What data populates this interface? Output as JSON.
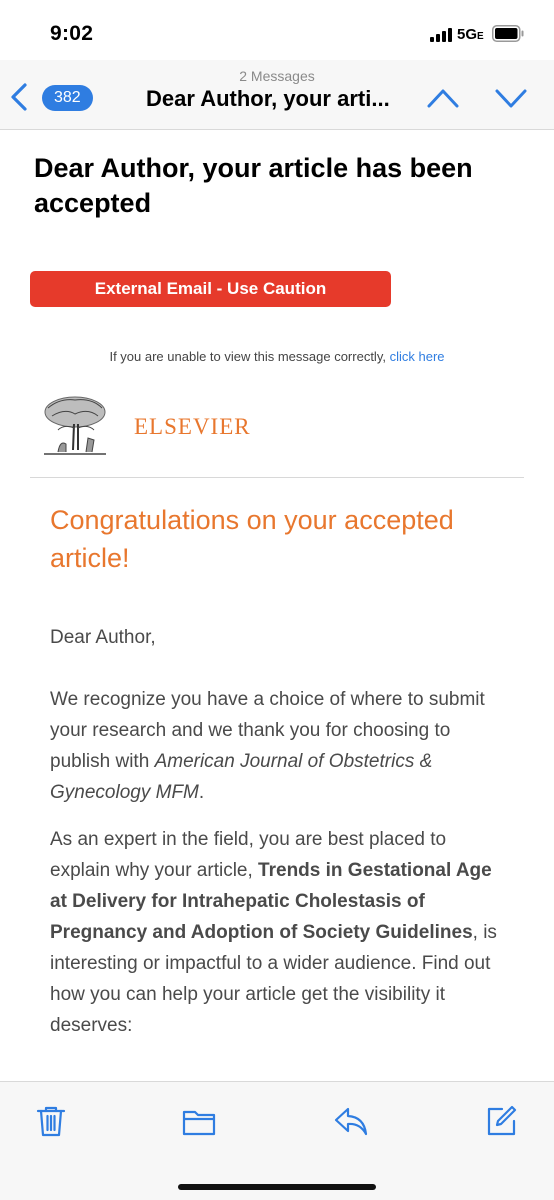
{
  "status_bar": {
    "time": "9:02",
    "network": "5G",
    "network_suffix": "E",
    "icons": [
      "signal-bars-icon",
      "battery-icon"
    ]
  },
  "nav": {
    "message_count_label": "2 Messages",
    "unread_badge": "382",
    "title": "Dear Author, your arti...",
    "icons": [
      "back-chevron-icon",
      "up-arrow-icon",
      "down-arrow-icon"
    ],
    "accent_color": "#2f7de1"
  },
  "email": {
    "subject": "Dear Author, your article has been accepted",
    "caution_banner": "External Email - Use Caution",
    "caution_color": "#e63a2b",
    "view_prompt": "If you are unable to view this message correctly,",
    "view_link": "click here",
    "logo_text": "ELSEVIER",
    "logo_color": "#e8772e",
    "heading": "Congratulations on your accepted article!",
    "greeting": "Dear Author,",
    "paragraph2": {
      "text_before": "We recognize you have a choice of where to submit your research and we thank you for choosing to publish with ",
      "journal": "American Journal of Obstetrics & Gynecology MFM",
      "text_after": "."
    },
    "paragraph3": {
      "text_before": "As an expert in the field, you are best placed to explain why your article, ",
      "article_title": "Trends in Gestational Age at Delivery for Intrahepatic Cholestasis of Pregnancy and Adoption of Society Guidelines",
      "text_after": ", is interesting or impactful to a wider audience. Find out how you can help your article get the visibility it deserves:"
    }
  },
  "toolbar": {
    "icons": [
      "trash-icon",
      "folder-icon",
      "reply-icon",
      "compose-icon"
    ],
    "accent_color": "#2f7de1"
  }
}
